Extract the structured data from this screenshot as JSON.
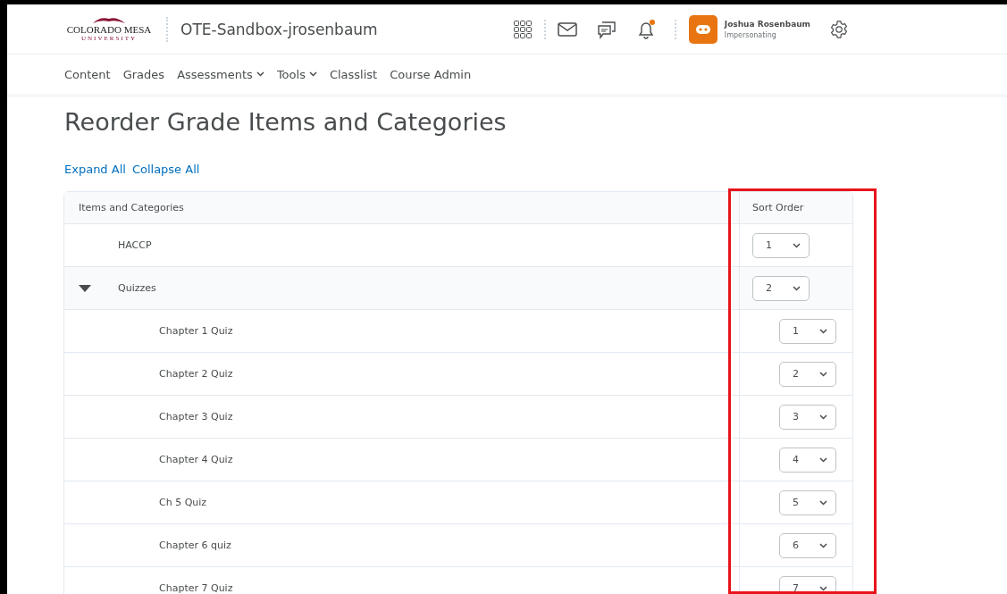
{
  "header": {
    "logo": {
      "name": "COLORADO MESA",
      "sub": "UNIVERSITY"
    },
    "course_title": "OTE-Sandbox-jrosenbaum",
    "notification_unread": true,
    "user": {
      "name": "Joshua Rosenbaum",
      "role": "Impersonating"
    }
  },
  "nav": [
    {
      "label": "Content",
      "dropdown": false
    },
    {
      "label": "Grades",
      "dropdown": false
    },
    {
      "label": "Assessments",
      "dropdown": true
    },
    {
      "label": "Tools",
      "dropdown": true
    },
    {
      "label": "Classlist",
      "dropdown": false
    },
    {
      "label": "Course Admin",
      "dropdown": false
    }
  ],
  "page_title": "Reorder Grade Items and Categories",
  "links": [
    "Expand All",
    "Collapse All"
  ],
  "table": {
    "columns": [
      "Items and Categories",
      "Sort Order"
    ],
    "rows": [
      {
        "name": "HACCP",
        "order": "1"
      },
      {
        "name": "Quizzes",
        "order": "2",
        "expanded": true,
        "children": [
          {
            "name": "Chapter 1 Quiz",
            "order": "1"
          },
          {
            "name": "Chapter 2 Quiz",
            "order": "2"
          },
          {
            "name": "Chapter 3 Quiz",
            "order": "3"
          },
          {
            "name": "Chapter 4 Quiz",
            "order": "4"
          },
          {
            "name": "Ch 5 Quiz",
            "order": "5"
          },
          {
            "name": "Chapter 6 quiz",
            "order": "6"
          },
          {
            "name": "Chapter 7 Quiz",
            "order": "7"
          }
        ]
      }
    ]
  }
}
